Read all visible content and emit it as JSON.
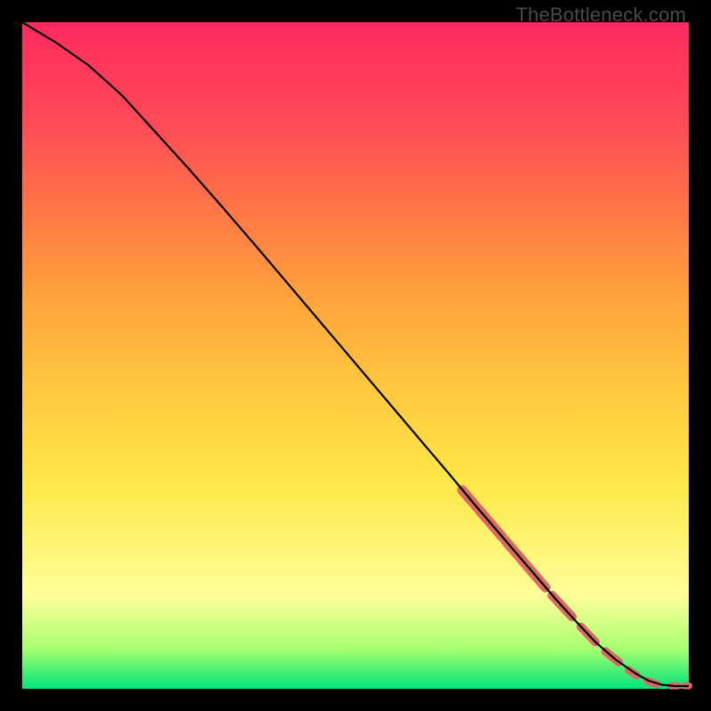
{
  "watermark": "TheBottleneck.com",
  "chart_data": {
    "type": "line",
    "title": "",
    "xlabel": "",
    "ylabel": "",
    "xlim": [
      0,
      100
    ],
    "ylim": [
      0,
      100
    ],
    "curve": {
      "name": "bottleneck-curve",
      "x": [
        0,
        5,
        10,
        15,
        20,
        25,
        30,
        35,
        40,
        45,
        50,
        55,
        60,
        64,
        68,
        71,
        74,
        77,
        80,
        83,
        86,
        89,
        92,
        94,
        96,
        98,
        100
      ],
      "y": [
        100,
        97,
        93.5,
        89,
        83.5,
        78,
        72.3,
        66.5,
        60.6,
        54.7,
        48.8,
        42.9,
        37,
        32.3,
        27.5,
        24,
        20.5,
        17,
        13.5,
        10.2,
        7,
        4.4,
        2.3,
        1.2,
        0.6,
        0.4,
        0.4
      ]
    },
    "marker_segments": [
      {
        "x1": 66,
        "y1": 29.8,
        "x2": 72,
        "y2": 22.8,
        "width": 7
      },
      {
        "x1": 72.5,
        "y1": 22.2,
        "x2": 78.5,
        "y2": 15.2,
        "width": 7
      },
      {
        "x1": 79.5,
        "y1": 14.0,
        "x2": 82.5,
        "y2": 10.8,
        "width": 6.5
      },
      {
        "x1": 83.8,
        "y1": 9.3,
        "x2": 86.0,
        "y2": 7.0,
        "width": 6
      },
      {
        "x1": 87.5,
        "y1": 5.6,
        "x2": 89.5,
        "y2": 4.0,
        "width": 6
      },
      {
        "x1": 91.0,
        "y1": 2.8,
        "x2": 92.2,
        "y2": 2.0,
        "width": 5.5
      },
      {
        "x1": 93.8,
        "y1": 1.2,
        "x2": 95.2,
        "y2": 0.7,
        "width": 5.5
      },
      {
        "x1": 97.3,
        "y1": 0.45,
        "x2": 98.3,
        "y2": 0.45,
        "width": 5
      },
      {
        "x1": 99.4,
        "y1": 0.45,
        "x2": 100.0,
        "y2": 0.45,
        "width": 5
      }
    ],
    "colors": {
      "curve": "#000000",
      "marker": "#d96a64"
    }
  }
}
